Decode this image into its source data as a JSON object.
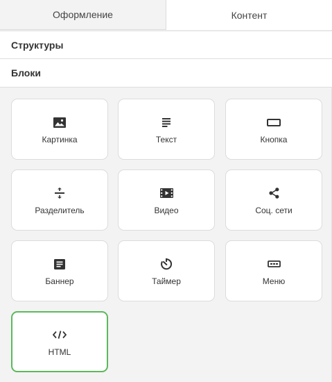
{
  "tabs": [
    {
      "label": "Оформление",
      "active": false
    },
    {
      "label": "Контент",
      "active": true
    }
  ],
  "sections": {
    "structures": "Структуры",
    "blocks": "Блоки"
  },
  "blocks": [
    {
      "label": "Картинка",
      "icon": "image-icon"
    },
    {
      "label": "Текст",
      "icon": "text-lines-icon"
    },
    {
      "label": "Кнопка",
      "icon": "button-icon"
    },
    {
      "label": "Разделитель",
      "icon": "divider-icon"
    },
    {
      "label": "Видео",
      "icon": "video-icon"
    },
    {
      "label": "Соц. сети",
      "icon": "share-icon"
    },
    {
      "label": "Баннер",
      "icon": "banner-icon"
    },
    {
      "label": "Таймер",
      "icon": "timer-icon"
    },
    {
      "label": "Меню",
      "icon": "menu-icon"
    },
    {
      "label": "HTML",
      "icon": "code-icon",
      "selected": true
    }
  ],
  "colors": {
    "selected_border": "#5cb85c",
    "icon": "#333333"
  }
}
